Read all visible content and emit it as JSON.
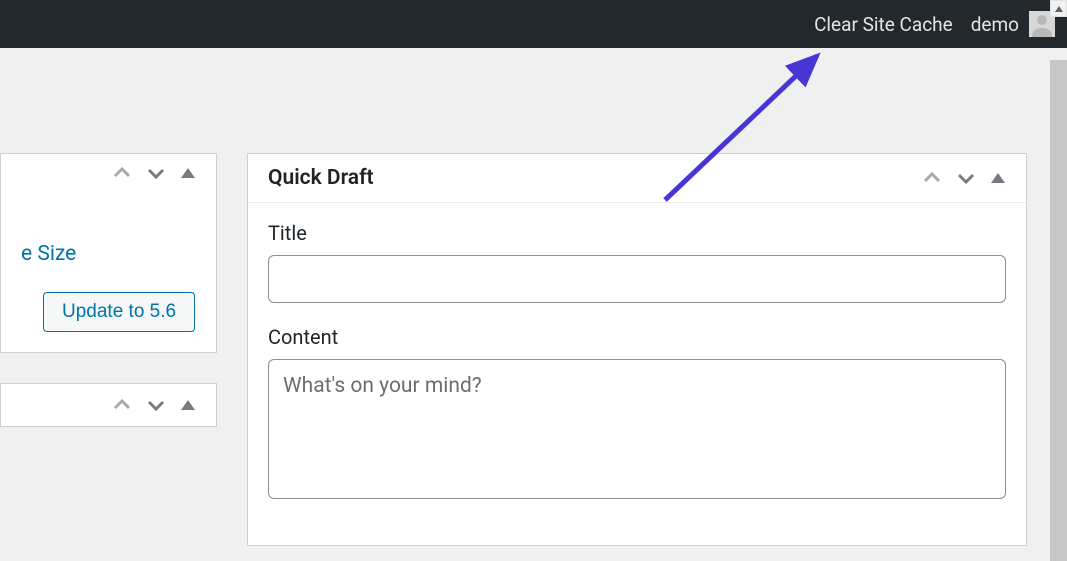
{
  "topbar": {
    "clear_cache": "Clear Site Cache",
    "username": "demo"
  },
  "left": {
    "size_link": "e Size",
    "update_button": "Update to 5.6"
  },
  "quick_draft": {
    "title": "Quick Draft",
    "title_label": "Title",
    "content_label": "Content",
    "content_placeholder": "What's on your mind?"
  }
}
